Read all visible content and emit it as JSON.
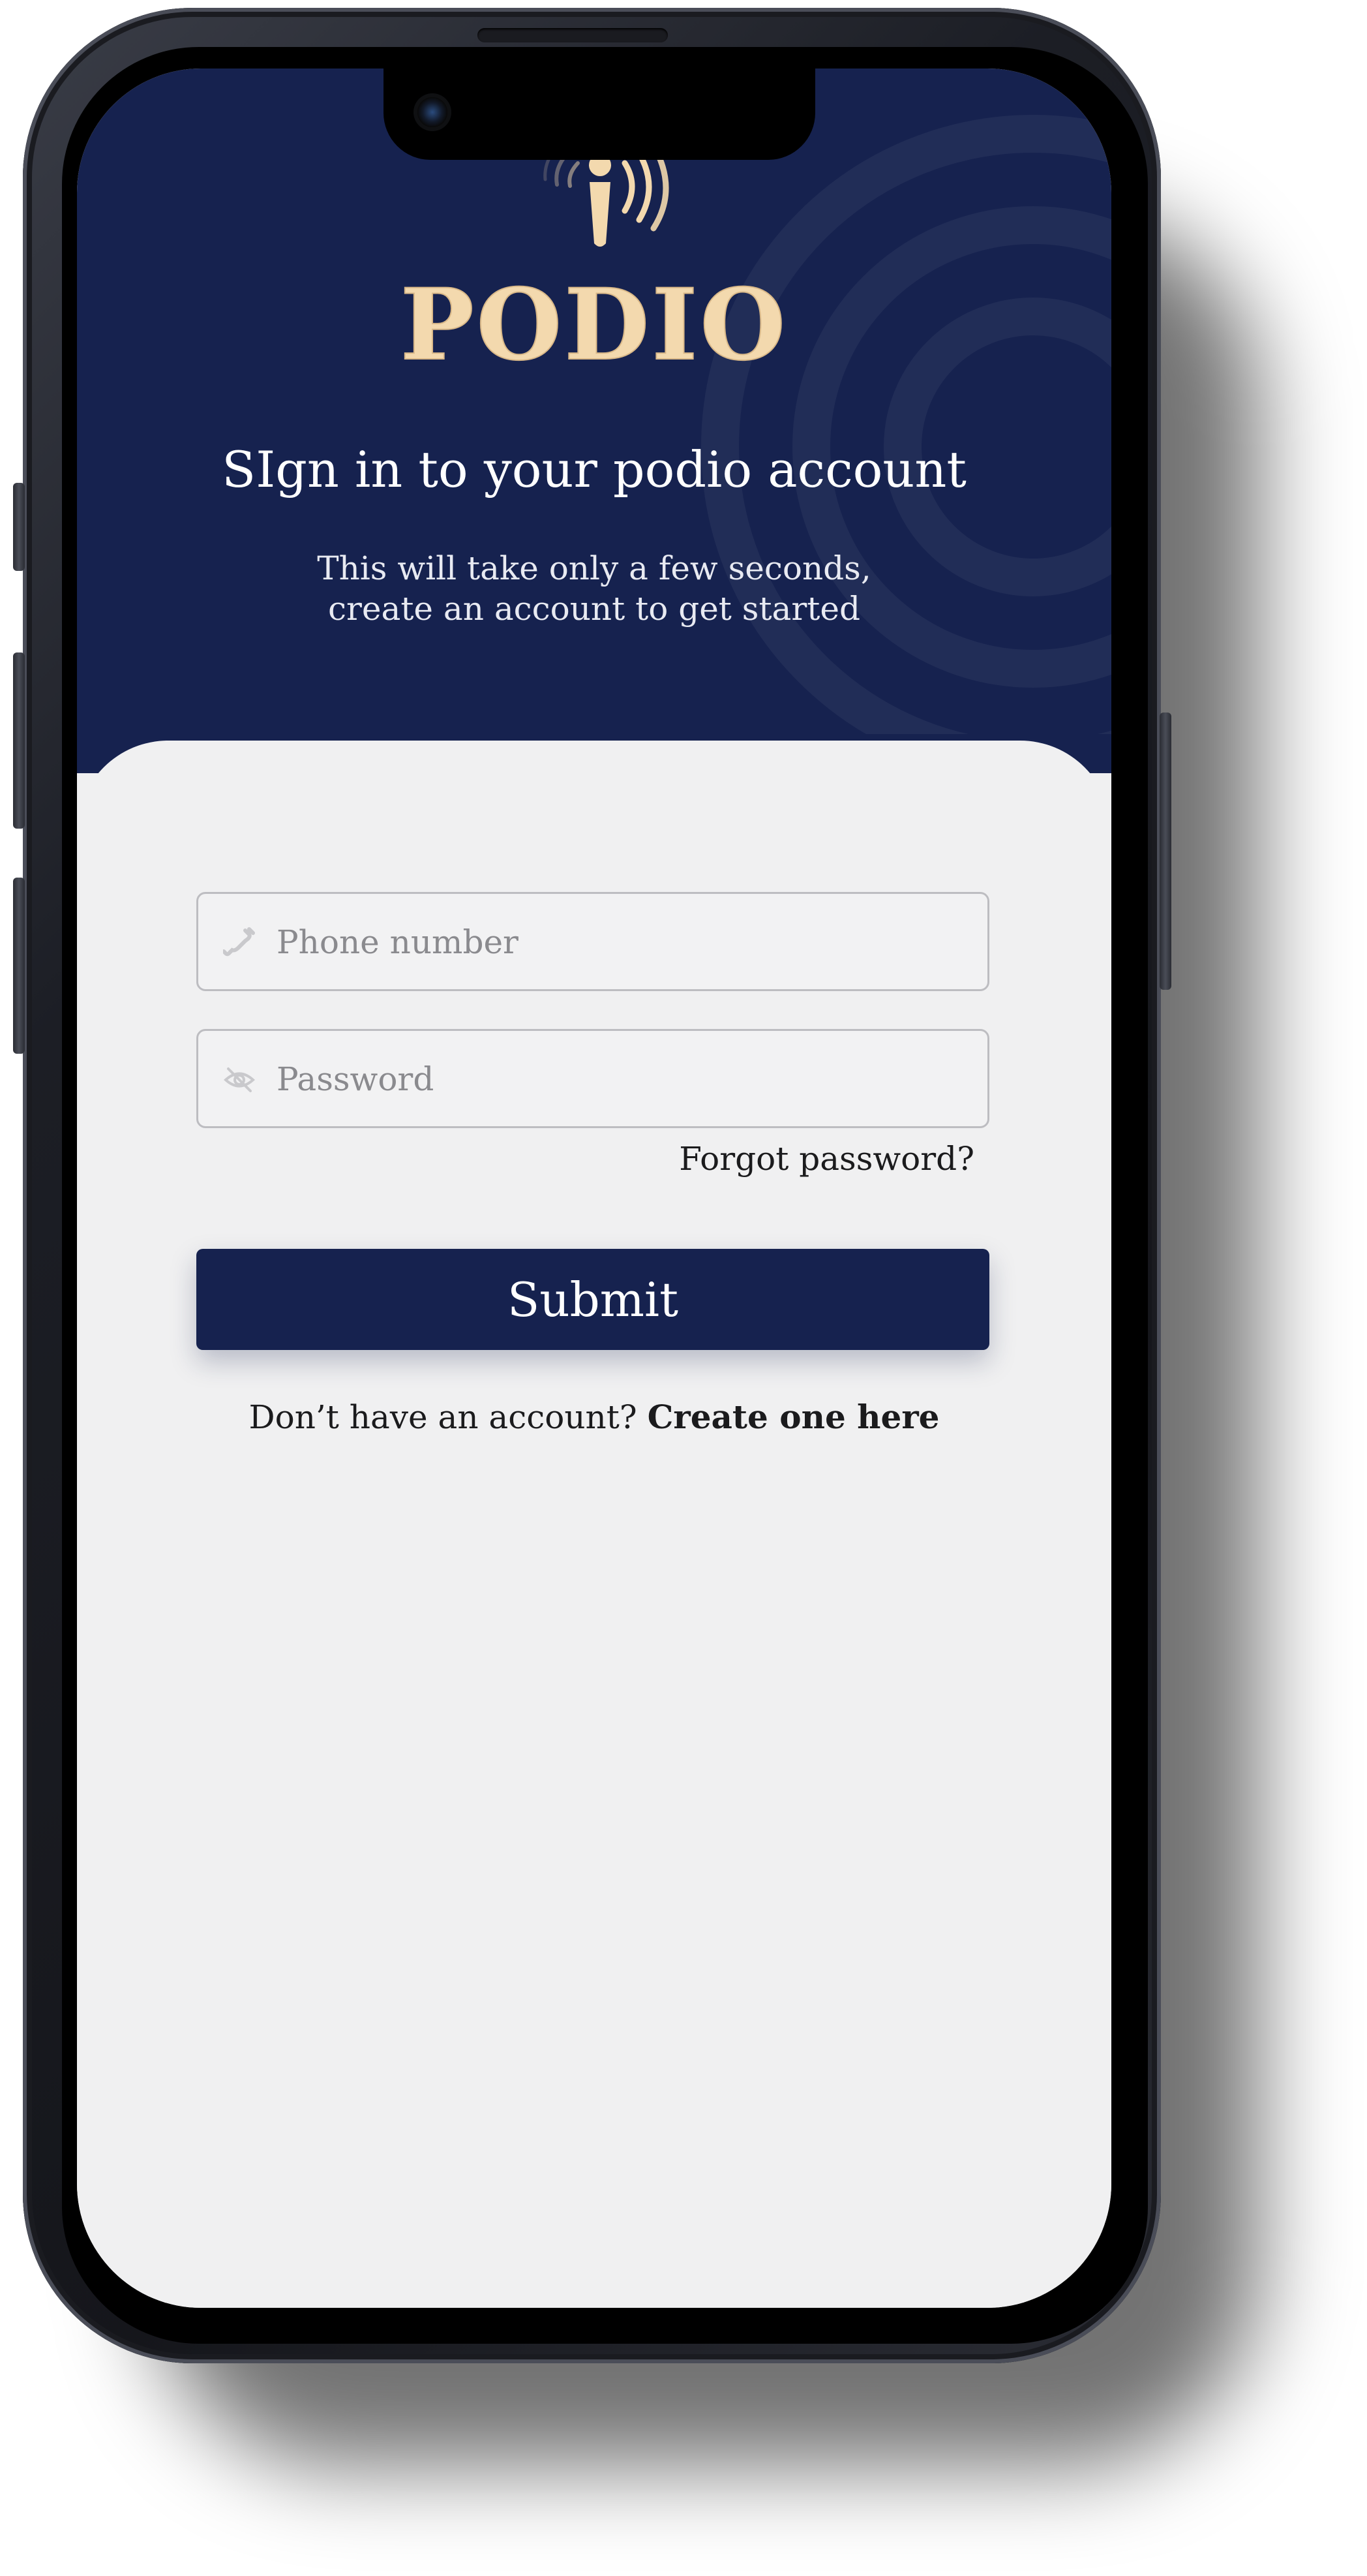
{
  "app": {
    "brand_name": "PODIO",
    "logo_icon": "podio-logo-icon"
  },
  "header": {
    "title": "SIgn in to your podio account",
    "subtitle": "This will take only a few seconds, create an account to get started"
  },
  "form": {
    "phone": {
      "placeholder": "Phone number",
      "value": "",
      "icon": "phone-icon"
    },
    "password": {
      "placeholder": "Password",
      "value": "",
      "icon": "eye-off-icon"
    },
    "forgot_label": "Forgot password?",
    "submit_label": "Submit",
    "signup_prompt": "Don’t have an account?",
    "signup_link": "Create one here"
  },
  "colors": {
    "primary_navy": "#16224f",
    "brand_gold": "#f3d9ae",
    "background": "#f0f0f1"
  }
}
